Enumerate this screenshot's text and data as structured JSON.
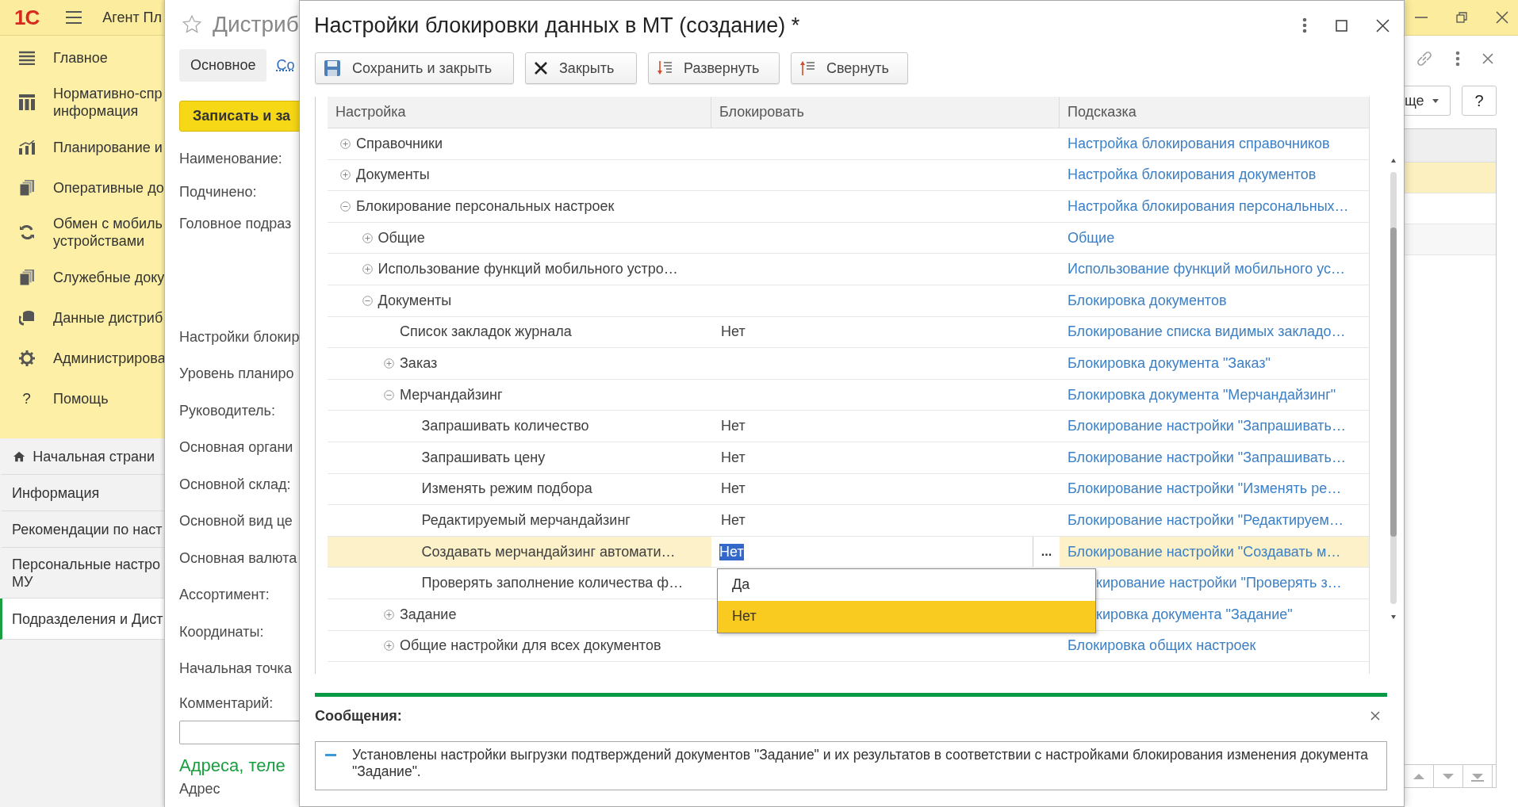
{
  "app": {
    "logo": "1С",
    "title": "Агент Пл"
  },
  "sidebar": {
    "sections": [
      {
        "label": "Главное"
      },
      {
        "label": "Нормативно-спр\nинформация"
      },
      {
        "label": "Планирование и"
      },
      {
        "label": "Оперативные до"
      },
      {
        "label": "Обмен с мобиль\nустройствами"
      },
      {
        "label": "Служебные доку"
      },
      {
        "label": "Данные дистриб"
      },
      {
        "label": "Администрирова"
      },
      {
        "label": "Помощь",
        "glyph": "?"
      }
    ],
    "home": "Начальная страни",
    "pages": [
      {
        "label": "Информация",
        "selected": false
      },
      {
        "label": "Рекомендации по наст",
        "selected": false
      },
      {
        "label": "Персональные настро\nМУ",
        "selected": false
      },
      {
        "label": "Подразделения и Дист",
        "selected": true
      }
    ]
  },
  "form": {
    "title": "Дистриб",
    "tabs": [
      {
        "label": "Основное",
        "selected": true
      },
      {
        "label": "Со",
        "selected": false
      }
    ],
    "save_button": "Записать и за",
    "fields": [
      "Наименование:",
      "Подчинено:",
      "Головное подраз",
      "Настройки блокир",
      "Уровень планиро",
      "Руководитель:",
      "Основная органи",
      "Основной склад:",
      "Основной вид це",
      "Основная валюта",
      "Ассортимент:",
      "Координаты:",
      "Начальная точка",
      "Комментарий:"
    ],
    "section": "Адреса, теле",
    "address_label": "Адрес",
    "more_button": "ще",
    "help_button": "?",
    "list_rows": [
      {
        "selected": true
      },
      {
        "selected": false
      },
      {
        "selected": false
      }
    ]
  },
  "dialog": {
    "title": "Настройки блокировки данных в МТ (создание) *",
    "toolbar": [
      "Сохранить и закрыть",
      "Закрыть",
      "Развернуть",
      "Свернуть"
    ],
    "table": {
      "columns": [
        "Настройка",
        "Блокировать",
        "Подсказка"
      ],
      "rows": [
        {
          "label": "Справочники",
          "expanded": false,
          "selected": false,
          "hint": "Настройка блокирования справочников"
        },
        {
          "label": "Документы",
          "expanded": false,
          "selected": false,
          "hint": "Настройка блокирования документов"
        },
        {
          "label": "Блокирование персональных настроек",
          "expanded": true,
          "selected": false,
          "hint": "Настройка блокирования персональных…",
          "children": [
            {
              "label": "Общие",
              "expanded": false,
              "selected": false,
              "hint": "Общие"
            },
            {
              "label": "Использование функций мобильного устро…",
              "expanded": false,
              "selected": false,
              "hint": "Использование функций мобильного ус…"
            },
            {
              "label": "Документы",
              "expanded": true,
              "selected": false,
              "hint": "Блокировка документов",
              "children": [
                {
                  "label": "Список закладок журнала",
                  "block": "Нет",
                  "selected": false,
                  "hint": "Блокирование списка видимых закладо…"
                },
                {
                  "label": "Заказ",
                  "expanded": false,
                  "selected": false,
                  "hint": "Блокировка документа \"Заказ\""
                },
                {
                  "label": "Мерчандайзинг",
                  "expanded": true,
                  "selected": false,
                  "hint": "Блокировка документа \"Мерчандайзинг\"",
                  "children": [
                    {
                      "label": "Запрашивать количество",
                      "block": "Нет",
                      "selected": false,
                      "hint": "Блокирование настройки \"Запрашивать…"
                    },
                    {
                      "label": "Запрашивать цену",
                      "block": "Нет",
                      "selected": false,
                      "hint": "Блокирование настройки \"Запрашивать…"
                    },
                    {
                      "label": "Изменять режим подбора",
                      "block": "Нет",
                      "selected": false,
                      "hint": "Блокирование настройки \"Изменять ре…"
                    },
                    {
                      "label": "Редактируемый мерчандайзинг",
                      "block": "Нет",
                      "selected": false,
                      "hint": "Блокирование настройки \"Редактируем…"
                    },
                    {
                      "label": "Создавать мерчандайзинг автомати…",
                      "block": "Нет",
                      "selected": true,
                      "hint": "Блокирование настройки \"Создавать м…"
                    },
                    {
                      "label": "Проверять заполнение количества ф…",
                      "selected": false,
                      "hint": "кирование настройки \"Проверять з…"
                    }
                  ]
                },
                {
                  "label": "Задание",
                  "expanded": false,
                  "selected": false,
                  "hint": "кировка документа \"Задание\""
                },
                {
                  "label": "Общие настройки для всех документов",
                  "expanded": false,
                  "selected": false,
                  "hint": "Блокировка общих настроек"
                }
              ]
            }
          ]
        }
      ],
      "choice_button": "...",
      "dropdown": {
        "options": [
          {
            "label": "Да",
            "selected": false
          },
          {
            "label": "Нет",
            "selected": true
          }
        ]
      }
    },
    "messages": {
      "title": "Сообщения:",
      "items": [
        {
          "text": "Установлены настройки выгрузки подтверждений документов \"Задание\" и их результатов в соответствии с настройками блокирования изменения документа \"Задание\"."
        }
      ]
    }
  }
}
